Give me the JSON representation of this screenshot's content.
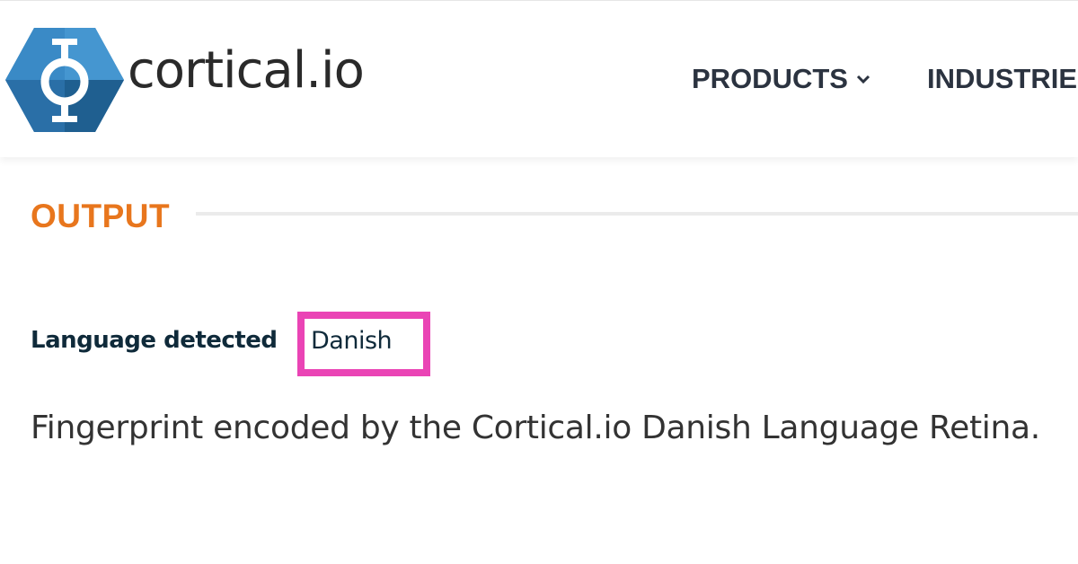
{
  "header": {
    "logo": {
      "text": "cortical.io",
      "icon": "hexagon-logo-icon",
      "colors": {
        "primary": "#2d7bb8",
        "dark": "#1f5f90",
        "light": "#6aa9d8"
      }
    },
    "nav": {
      "items": [
        {
          "label": "PRODUCTS",
          "icon": "chevron-down-icon"
        },
        {
          "label": "INDUSTRIES",
          "icon": "chevron-down-icon"
        }
      ]
    }
  },
  "main": {
    "section_title": "OUTPUT",
    "language": {
      "label": "Language detected",
      "value": "Danish"
    },
    "description": "Fingerprint encoded by the Cortical.io Danish Language Retina."
  },
  "colors": {
    "accent": "#e8761d",
    "highlight": "#ea44b5",
    "nav_text": "#2b3340"
  }
}
